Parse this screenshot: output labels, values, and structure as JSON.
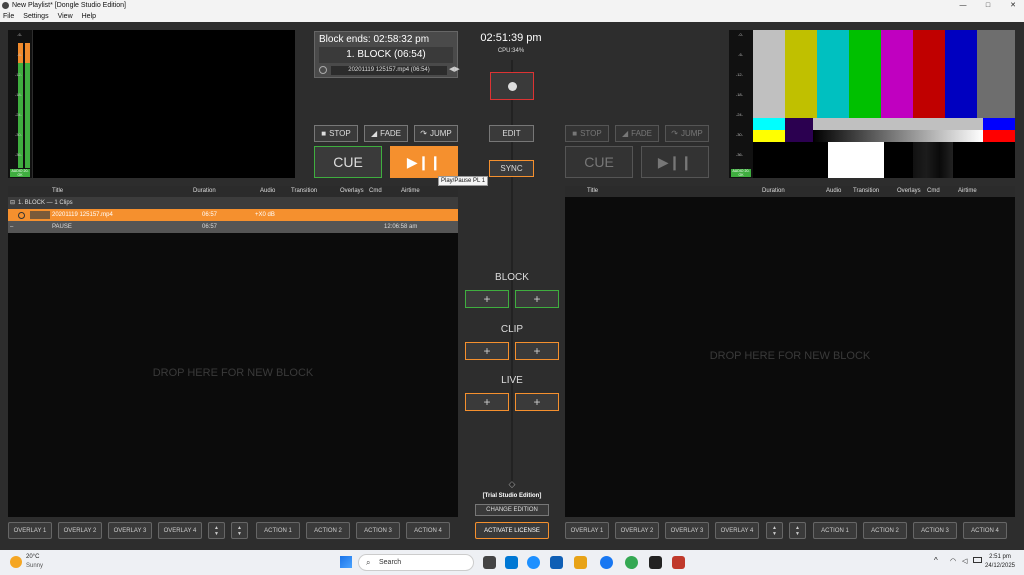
{
  "window": {
    "title": "New Playlist* [Dongle Studio Edition]",
    "minimize": "—",
    "maximize": "□",
    "close": "✕"
  },
  "menu": [
    "File",
    "Settings",
    "View",
    "Help"
  ],
  "meter_left": {
    "levels": [
      "-6-",
      "-6-",
      "-12-",
      "-18-",
      "-24-",
      "-30-",
      "-36-"
    ],
    "label": "AUDIO 20-OK",
    "level_fraction": 0.82,
    "peak_fraction": 0.14
  },
  "meter_right": {
    "levels": [
      "-0-",
      "-6-",
      "-12-",
      "-18-",
      "-24-",
      "-30-",
      "-36-"
    ],
    "label": "AUDIO 20-OK"
  },
  "block_status": {
    "ends": "Block ends: 02:58:32 pm",
    "name": "1. BLOCK (06:54)",
    "clip": "20201119 125157.mp4 (06:54)"
  },
  "clock": "02:51:39 pm",
  "cpu": "CPU:34%",
  "left_transport": {
    "stop": "STOP",
    "fade": "FADE",
    "jump": "JUMP",
    "cue": "CUE",
    "play": "▶❙❙"
  },
  "right_transport": {
    "stop": "STOP",
    "fade": "FADE",
    "jump": "JUMP",
    "cue": "CUE",
    "play": "▶❙❙"
  },
  "center": {
    "edit": "EDIT",
    "sync": "SYNC",
    "tooltip": "Play/Pause PL 1",
    "block": "BLOCK",
    "clip": "CLIP",
    "live": "LIVE",
    "plus": "+",
    "edition": "[Trial Studio Edition]",
    "change": "CHANGE EDITION",
    "activate": "ACTIVATE LICENSE",
    "arrows": "◇"
  },
  "columns": {
    "title": "Title",
    "duration": "Duration",
    "audio": "Audio",
    "transition": "Transition",
    "overlays": "Overlays",
    "cmd": "Cmd",
    "airtime": "Airtime"
  },
  "left_list": {
    "block_row": "1. BLOCK — 1 Clips",
    "clip": {
      "title": "20201119 125157.mp4",
      "duration": "06:57",
      "audio": "+X0 dB"
    },
    "pause": {
      "title": "PAUSE",
      "duration": "06:57",
      "airtime": "12:06:58 am"
    },
    "drop": "DROP HERE FOR NEW BLOCK"
  },
  "right_list": {
    "drop": "DROP HERE FOR NEW BLOCK"
  },
  "bottom_left": [
    "OVERLAY 1",
    "OVERLAY 2",
    "OVERLAY 3",
    "OVERLAY 4",
    "ACTION 1",
    "ACTION 2",
    "ACTION 3",
    "ACTION 4"
  ],
  "bottom_right": [
    "OVERLAY 1",
    "OVERLAY 2",
    "OVERLAY 3",
    "OVERLAY 4",
    "ACTION 1",
    "ACTION 2",
    "ACTION 3",
    "ACTION 4"
  ],
  "updown": {
    "up": "▲",
    "down": "▼"
  },
  "taskbar": {
    "weather_temp": "20°C",
    "weather_desc": "Sunny",
    "search": "Search",
    "time": "2:51 pm",
    "date": "24/12/2025",
    "tray": "^"
  },
  "colors": {
    "accent": "#f5902e",
    "green": "#3fae3f",
    "bg": "#2d2d2d"
  },
  "colorbars": [
    "#bfbfbf",
    "#c0c000",
    "#00c0c0",
    "#00c000",
    "#c000c0",
    "#c00000",
    "#0000c0"
  ]
}
